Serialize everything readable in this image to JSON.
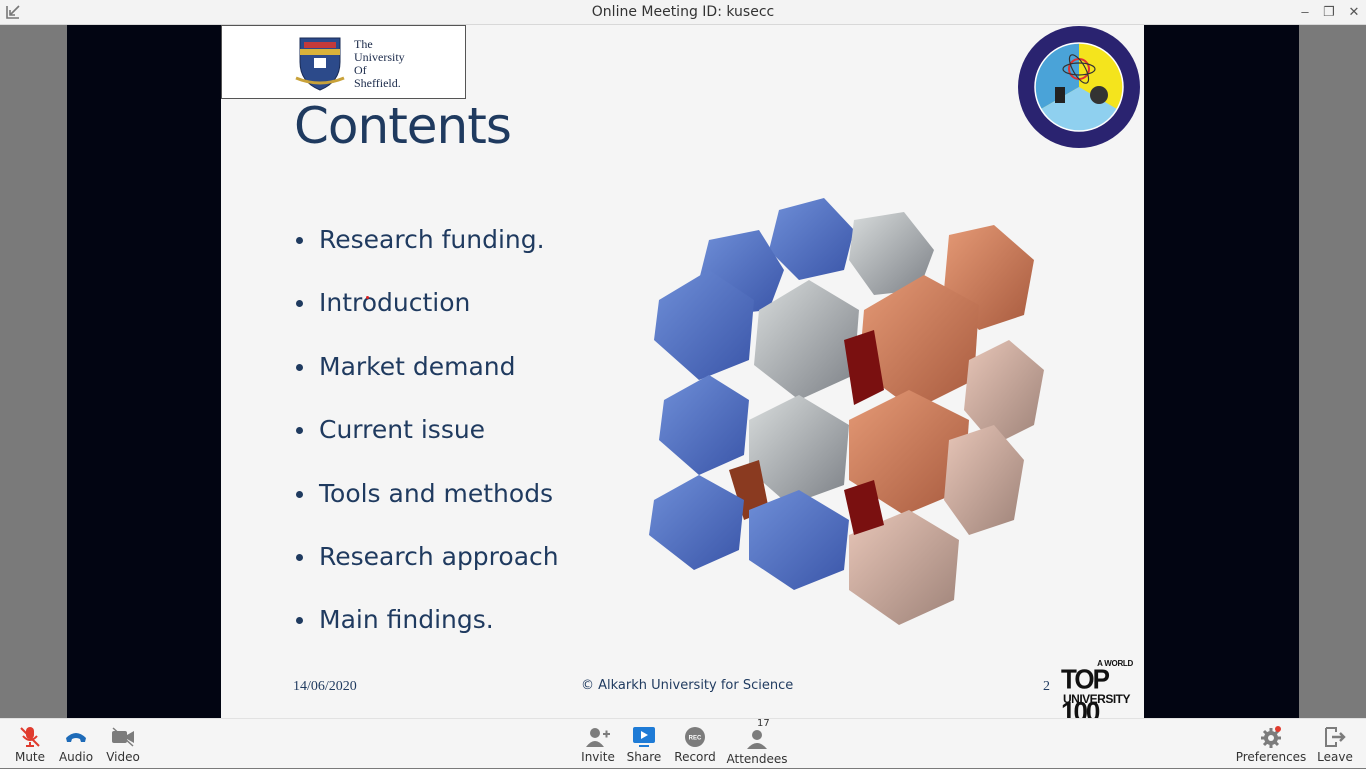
{
  "window": {
    "title": "Online Meeting ID: kusecc",
    "controls": {
      "minimize": "–",
      "restore": "❐",
      "close": "✕"
    }
  },
  "slide": {
    "header_logo_text": [
      "The",
      "University",
      "Of",
      "Sheffield."
    ],
    "title": "Contents",
    "bullets": [
      "Research funding.",
      "Introduction",
      "Market demand",
      "Current issue",
      "Tools and methods",
      "Research approach",
      "Main findings."
    ],
    "footer": {
      "date": "14/06/2020",
      "copyright": "© Alkarkh University for Science",
      "page_number": "2",
      "badge_top": "A WORLD",
      "badge_main": "TOP 100",
      "badge_bottom": "UNIVERSITY"
    }
  },
  "toolbar": {
    "left": [
      {
        "label": "Mute",
        "icon": "microphone-muted-icon"
      },
      {
        "label": "Audio",
        "icon": "phone-icon"
      },
      {
        "label": "Video",
        "icon": "video-camera-icon"
      }
    ],
    "center": [
      {
        "label": "Invite",
        "icon": "add-user-icon"
      },
      {
        "label": "Share",
        "icon": "screen-share-icon"
      },
      {
        "label": "Record",
        "icon": "record-icon",
        "icon_text": "REC"
      },
      {
        "label": "Attendees",
        "icon": "attendees-icon",
        "count": "17"
      }
    ],
    "right": [
      {
        "label": "Preferences",
        "icon": "gear-icon"
      },
      {
        "label": "Leave",
        "icon": "leave-icon"
      }
    ]
  },
  "colors": {
    "slide_text": "#1f3a5f",
    "share_active": "#1e7bd6",
    "mute_red": "#e03b2e",
    "frame_bg": "#020512"
  }
}
